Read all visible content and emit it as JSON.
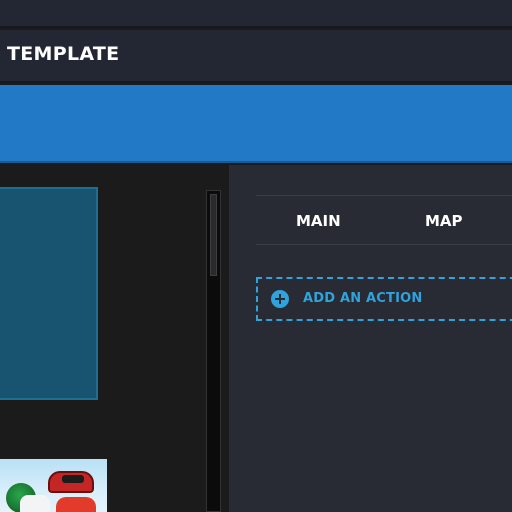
{
  "header": {
    "title": "TEMPLATE"
  },
  "tabs": [
    {
      "label": "MAIN"
    },
    {
      "label": "MAP"
    }
  ],
  "add_action": {
    "label": "ADD AN ACTION",
    "icon": "plus-circle-icon"
  },
  "colors": {
    "accent_blue": "#2279c6",
    "action_blue": "#2ea3dc",
    "panel_dark": "#282a34",
    "header_dark": "#232733"
  }
}
